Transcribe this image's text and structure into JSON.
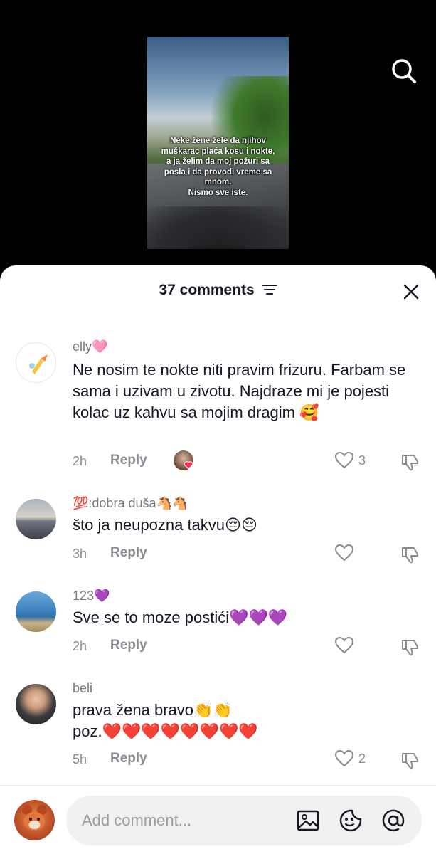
{
  "video": {
    "overlay_text": "Neke žene žele da njihov\nmuškarac plaća kosu i nokte,\na ja želim da moj požuri sa\nposla i da provodi vreme sa\nmnom.\nNismo sve iste."
  },
  "comments_header": {
    "count_label": "37 comments"
  },
  "comments": [
    {
      "username": "elly🩷",
      "text": "Ne nosim te nokte niti pravim frizuru. Farbam se sama i uzivam u zivotu. Najdraze mi je pojesti kolac uz kahvu sa mojim dragim 🥰",
      "time": "2h",
      "reply_label": "Reply",
      "likes": "3",
      "creator_liked": true
    },
    {
      "username": "💯:dobra duša🐴🐴",
      "text": "što ja neupozna takvu😔😔",
      "time": "3h",
      "reply_label": "Reply",
      "likes": ""
    },
    {
      "username": "123💜",
      "text": "Sve se to moze postići💜💜💜",
      "time": "2h",
      "reply_label": "Reply",
      "likes": ""
    },
    {
      "username": "beli",
      "text": "prava žena bravo👏👏\npoz.❤️❤️❤️❤️❤️❤️❤️❤️",
      "time": "5h",
      "reply_label": "Reply",
      "likes": "2"
    }
  ],
  "composer": {
    "placeholder": "Add comment..."
  },
  "icons": {
    "search": "search-icon",
    "sort": "sort-lines-icon",
    "close": "close-icon",
    "like": "heart-outline-icon",
    "dislike": "thumbs-down-icon",
    "image": "image-icon",
    "sticker": "sticker-smile-icon",
    "mention": "at-sign-icon"
  },
  "colors": {
    "text": "#161823",
    "muted": "#8a8b91",
    "background": "#ffffff"
  }
}
